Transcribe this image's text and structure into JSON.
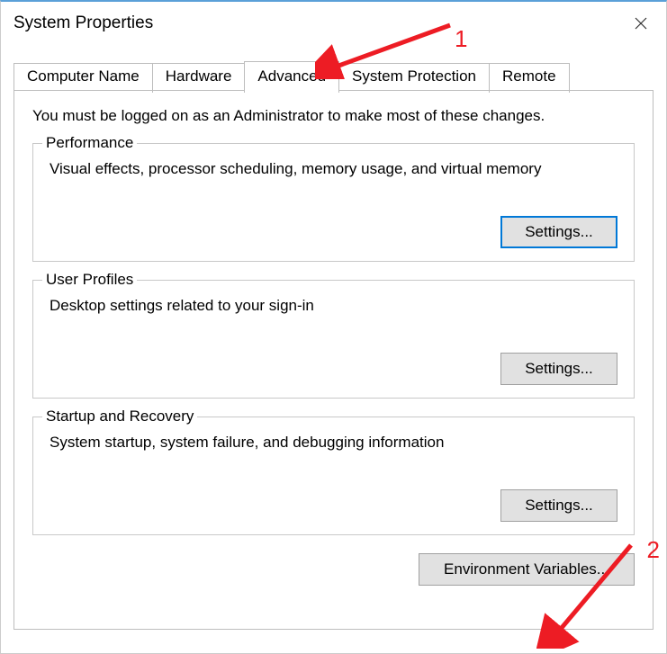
{
  "window": {
    "title": "System Properties"
  },
  "tabs": {
    "computer_name": "Computer Name",
    "hardware": "Hardware",
    "advanced": "Advanced",
    "system_protection": "System Protection",
    "remote": "Remote"
  },
  "panel": {
    "info": "You must be logged on as an Administrator to make most of these changes.",
    "performance": {
      "legend": "Performance",
      "desc": "Visual effects, processor scheduling, memory usage, and virtual memory",
      "button": "Settings..."
    },
    "user_profiles": {
      "legend": "User Profiles",
      "desc": "Desktop settings related to your sign-in",
      "button": "Settings..."
    },
    "startup": {
      "legend": "Startup and Recovery",
      "desc": "System startup, system failure, and debugging information",
      "button": "Settings..."
    },
    "env_button": "Environment Variables..."
  },
  "annotations": {
    "one": "1",
    "two": "2"
  }
}
